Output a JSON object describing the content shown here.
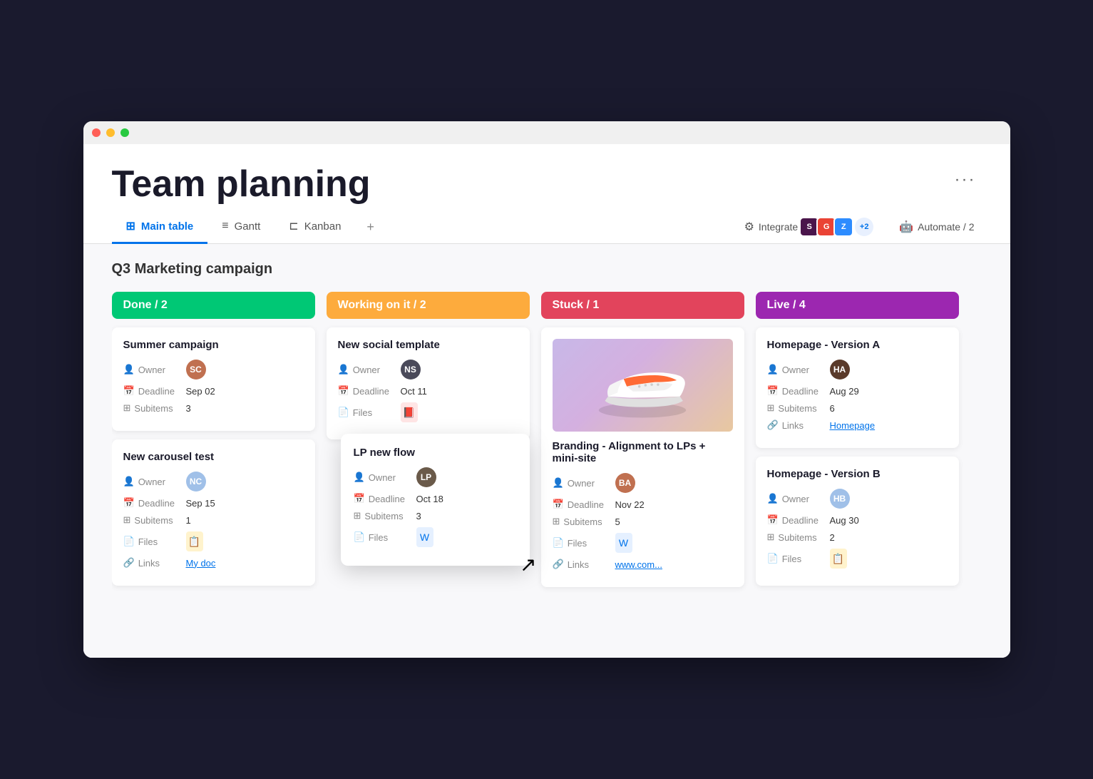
{
  "window": {
    "dots": [
      "red",
      "yellow",
      "green"
    ]
  },
  "header": {
    "title": "Team planning",
    "more_label": "···"
  },
  "tabs": [
    {
      "id": "main-table",
      "label": "Main table",
      "icon": "grid",
      "active": true
    },
    {
      "id": "gantt",
      "label": "Gantt",
      "icon": "gantt",
      "active": false
    },
    {
      "id": "kanban",
      "label": "Kanban",
      "icon": "kanban",
      "active": false
    }
  ],
  "tab_add_label": "+",
  "toolbar": {
    "integrate_label": "Integrate",
    "automate_label": "Automate / 2",
    "plus_badge": "+2"
  },
  "board": {
    "section_title": "Q3 Marketing campaign",
    "columns": [
      {
        "id": "done",
        "label": "Done / 2",
        "color": "done",
        "cards": [
          {
            "id": "summer-campaign",
            "title": "Summer campaign",
            "owner_label": "Owner",
            "deadline_label": "Deadline",
            "deadline_value": "Sep 02",
            "subitems_label": "Subitems",
            "subitems_value": "3",
            "avatar_initials": "SC",
            "avatar_bg": "#e8a0a0"
          },
          {
            "id": "new-carousel",
            "title": "New carousel test",
            "owner_label": "Owner",
            "deadline_label": "Deadline",
            "deadline_value": "Sep 15",
            "subitems_label": "Subitems",
            "subitems_value": "1",
            "files_label": "Files",
            "links_label": "Links",
            "links_value": "My doc",
            "avatar_initials": "NC",
            "avatar_bg": "#a0c0e8"
          }
        ]
      },
      {
        "id": "working",
        "label": "Working on it / 2",
        "color": "working",
        "cards": [
          {
            "id": "new-social",
            "title": "New social template",
            "owner_label": "Owner",
            "deadline_label": "Deadline",
            "deadline_value": "Oct 11",
            "files_label": "Files",
            "avatar_initials": "NS",
            "avatar_bg": "#4a4a5a"
          }
        ]
      },
      {
        "id": "stuck",
        "label": "Stuck / 1",
        "color": "stuck",
        "cards": [
          {
            "id": "branding",
            "title": "Branding - Alignment to LPs + mini-site",
            "has_image": true,
            "owner_label": "Owner",
            "deadline_label": "Deadline",
            "deadline_value": "Nov 22",
            "subitems_label": "Subitems",
            "subitems_value": "5",
            "files_label": "Files",
            "links_label": "Links",
            "links_value": "www.com...",
            "avatar_initials": "BA",
            "avatar_bg": "#c07050"
          }
        ]
      },
      {
        "id": "live",
        "label": "Live / 4",
        "color": "live",
        "cards": [
          {
            "id": "homepage-a",
            "title": "Homepage - Version A",
            "owner_label": "Owner",
            "deadline_label": "Deadline",
            "deadline_value": "Aug 29",
            "subitems_label": "Subitems",
            "subitems_value": "6",
            "links_label": "Links",
            "links_value": "Homepage",
            "avatar_initials": "HA",
            "avatar_bg": "#5a3a2a"
          },
          {
            "id": "homepage-b",
            "title": "Homepage - Version B",
            "owner_label": "Owner",
            "deadline_label": "Deadline",
            "deadline_value": "Aug 30",
            "subitems_label": "Subitems",
            "subitems_value": "2",
            "files_label": "Files",
            "avatar_initials": "HB",
            "avatar_bg": "#a0c0e8"
          }
        ]
      }
    ]
  },
  "floating_card": {
    "title": "LP new flow",
    "owner_label": "Owner",
    "deadline_label": "Deadline",
    "deadline_value": "Oct 18",
    "subitems_label": "Subitems",
    "subitems_value": "3",
    "files_label": "Files",
    "avatar_initials": "LP",
    "avatar_bg": "#6a5a4a"
  },
  "labels": {
    "owner": "Owner",
    "deadline": "Deadline",
    "subitems": "Subitems",
    "files": "Files",
    "links": "Links"
  }
}
